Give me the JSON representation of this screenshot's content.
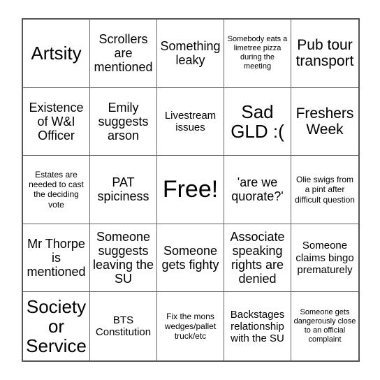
{
  "card": {
    "title": "Bingo Card",
    "columns": 5,
    "rows": 5,
    "free_space_index": 12,
    "colors": {
      "background": "#ffffff",
      "border": "#555555",
      "inner_border": "#666666",
      "text": "#000000"
    },
    "cells": [
      {
        "text": "Artsity",
        "size": "fs-xl"
      },
      {
        "text": "Scrollers are mentioned",
        "size": "fs-md"
      },
      {
        "text": "Something leaky",
        "size": "fs-md"
      },
      {
        "text": "Somebody eats a limetree pizza during the meeting",
        "size": "fs-xxs"
      },
      {
        "text": "Pub tour transport",
        "size": "fs-lg"
      },
      {
        "text": "Existence of W&I Officer",
        "size": "fs-md"
      },
      {
        "text": "Emily suggests arson",
        "size": "fs-md"
      },
      {
        "text": "Livestream issues",
        "size": "fs-sm"
      },
      {
        "text": "Sad GLD :(",
        "size": "fs-xl"
      },
      {
        "text": "Freshers Week",
        "size": "fs-lg"
      },
      {
        "text": "Estates are needed to cast the deciding vote",
        "size": "fs-xs"
      },
      {
        "text": "PAT spiciness",
        "size": "fs-md"
      },
      {
        "text": "Free!",
        "size": "fs-xxl"
      },
      {
        "text": "'are we quorate?'",
        "size": "fs-md"
      },
      {
        "text": "Olie swigs from a pint after difficult question",
        "size": "fs-xs"
      },
      {
        "text": "Mr Thorpe is mentioned",
        "size": "fs-md"
      },
      {
        "text": "Someone suggests leaving the SU",
        "size": "fs-md"
      },
      {
        "text": "Someone gets fighty",
        "size": "fs-md"
      },
      {
        "text": "Associate speaking rights are denied",
        "size": "fs-md"
      },
      {
        "text": "Someone claims bingo prematurely",
        "size": "fs-sm"
      },
      {
        "text": "Society or Service",
        "size": "fs-xl"
      },
      {
        "text": "BTS Constitution",
        "size": "fs-sm"
      },
      {
        "text": "Fix the mons wedges/pallet truck/etc",
        "size": "fs-xs"
      },
      {
        "text": "Backstages relationship with the SU",
        "size": "fs-sm"
      },
      {
        "text": "Someone gets dangerously close to an official complaint",
        "size": "fs-xxs"
      }
    ]
  }
}
